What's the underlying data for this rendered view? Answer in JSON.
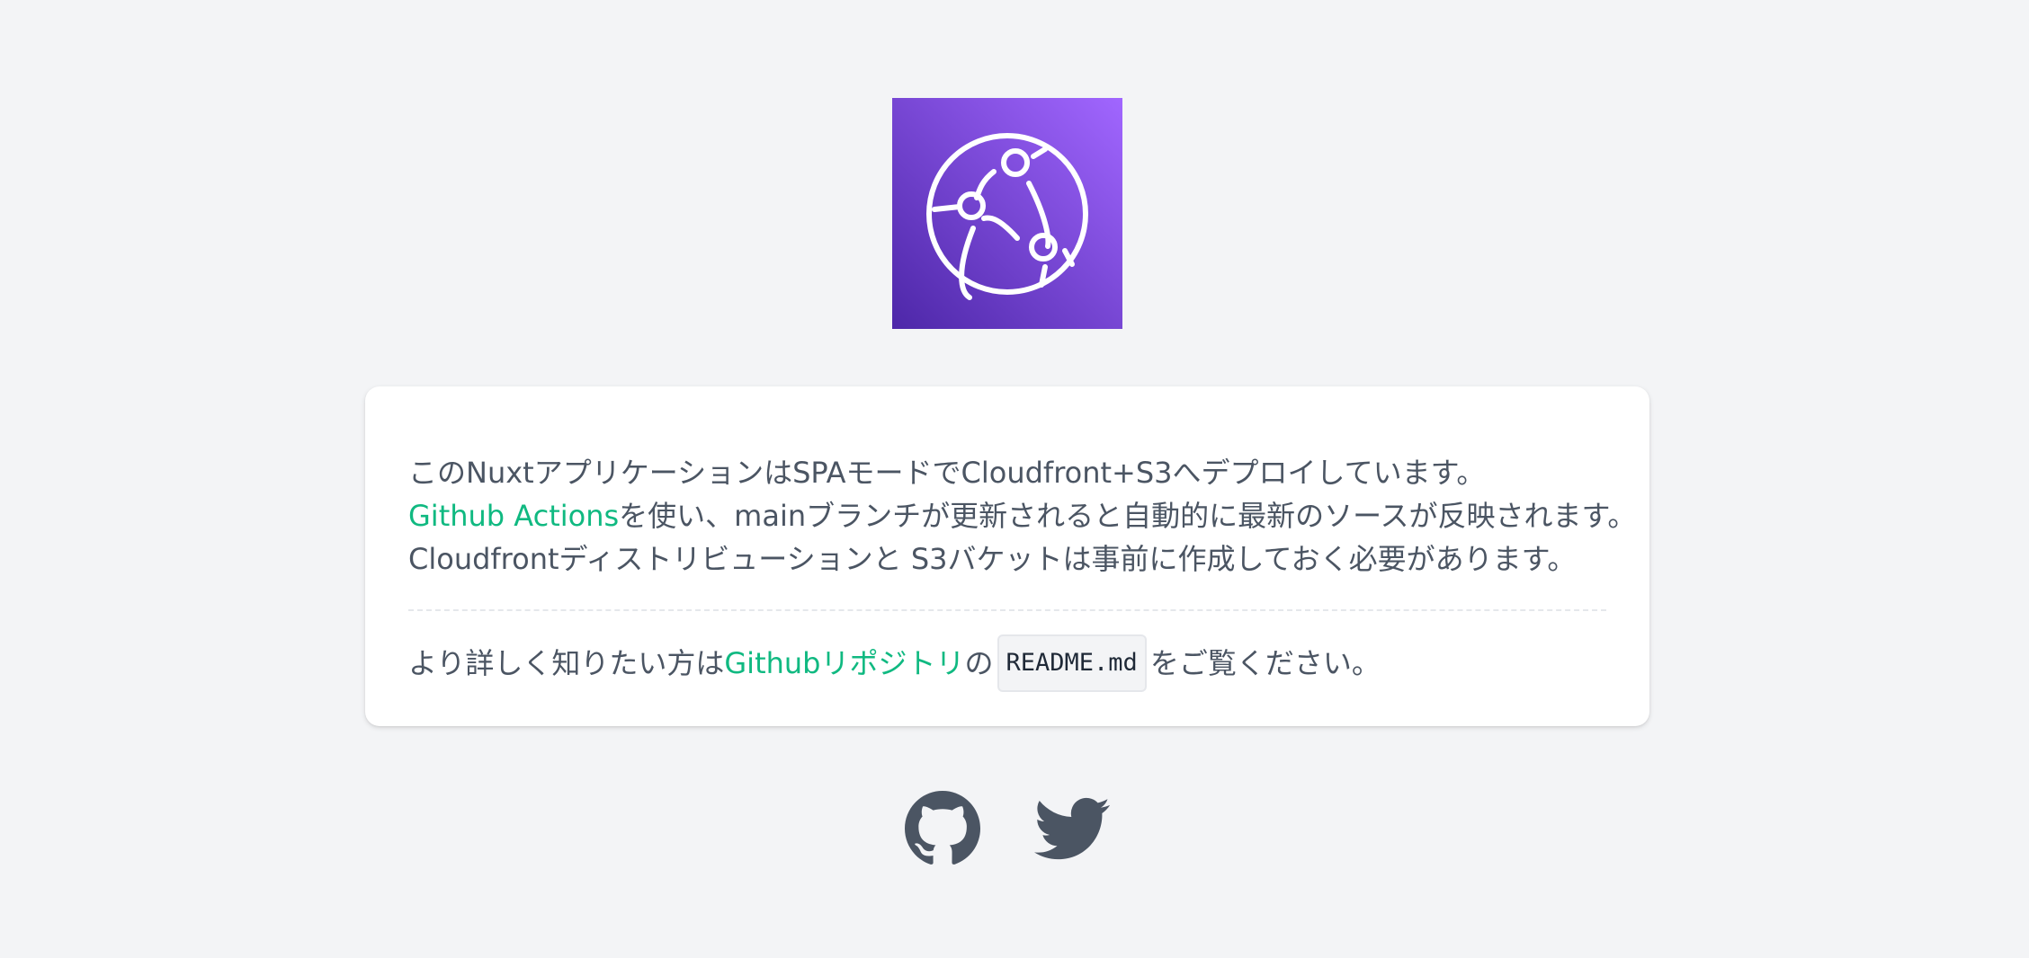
{
  "logo": {
    "icon": "cloudfront-icon",
    "gradient_from": "#4d27a8",
    "gradient_to": "#a166ff"
  },
  "intro": {
    "line1": "このNuxtアプリケーションはSPAモードでCloudfront+S3へデプロイしています。",
    "line2_link": "Github Actions",
    "line2_rest": "を使い、mainブランチが更新されると自動的に最新のソースが反映されます。",
    "line3": "Cloudfrontディストリビューションと S3バケットは事前に作成しておく必要があります。"
  },
  "more": {
    "prefix": "より詳しく知りたい方は",
    "repo_link": "Githubリポジトリ",
    "connector": "の",
    "readme_code": "README.md",
    "suffix": "をご覧ください。"
  },
  "socials": [
    {
      "icon": "github-icon"
    },
    {
      "icon": "twitter-icon"
    }
  ],
  "colors": {
    "background": "#f3f4f6",
    "text": "#4b5563",
    "link": "#10b981",
    "icon": "#4b5563"
  }
}
